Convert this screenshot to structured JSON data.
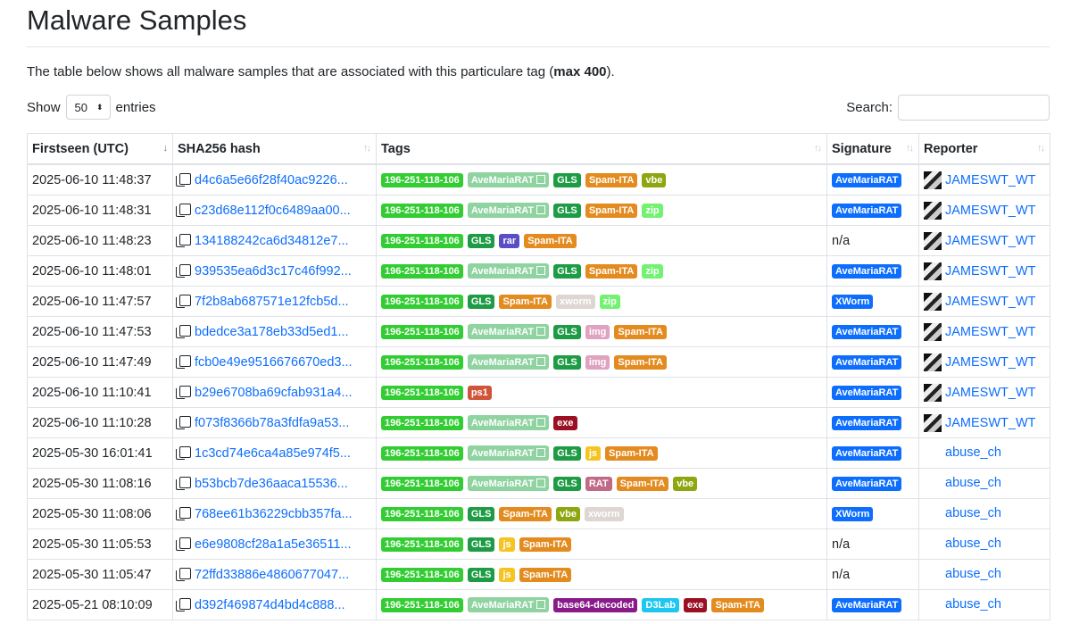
{
  "title": "Malware Samples",
  "intro_prefix": "The table below shows all malware samples that are associated with this particulare tag (",
  "intro_bold": "max 400",
  "intro_suffix": ").",
  "length": {
    "show": "Show",
    "value": "50",
    "entries": "entries"
  },
  "search": {
    "label": "Search:",
    "value": ""
  },
  "columns": [
    "Firstseen (UTC)",
    "SHA256 hash",
    "Tags",
    "Signature",
    "Reporter"
  ],
  "rows": [
    {
      "date": "2025-06-10 11:48:37",
      "hash": "d4c6a5e66f28f40ac9226...",
      "tags": [
        [
          "196-251-118-106",
          "ip"
        ],
        [
          "AveMariaRAT",
          "ave"
        ],
        [
          "GLS",
          "gls"
        ],
        [
          "Spam-ITA",
          "spam"
        ],
        [
          "vbe",
          "vbe"
        ]
      ],
      "signature": "AveMariaRAT",
      "reporter": "JAMESWT_WT",
      "rep_icon": "avatar"
    },
    {
      "date": "2025-06-10 11:48:31",
      "hash": "c23d68e112f0c6489aa00...",
      "tags": [
        [
          "196-251-118-106",
          "ip"
        ],
        [
          "AveMariaRAT",
          "ave"
        ],
        [
          "GLS",
          "gls"
        ],
        [
          "Spam-ITA",
          "spam"
        ],
        [
          "zip",
          "zip"
        ]
      ],
      "signature": "AveMariaRAT",
      "reporter": "JAMESWT_WT",
      "rep_icon": "avatar"
    },
    {
      "date": "2025-06-10 11:48:23",
      "hash": "134188242ca6d34812e7...",
      "tags": [
        [
          "196-251-118-106",
          "ip"
        ],
        [
          "GLS",
          "gls"
        ],
        [
          "rar",
          "rar"
        ],
        [
          "Spam-ITA",
          "spam"
        ]
      ],
      "signature": "",
      "signature_text": "n/a",
      "reporter": "JAMESWT_WT",
      "rep_icon": "avatar"
    },
    {
      "date": "2025-06-10 11:48:01",
      "hash": "939535ea6d3c17c46f992...",
      "tags": [
        [
          "196-251-118-106",
          "ip"
        ],
        [
          "AveMariaRAT",
          "ave"
        ],
        [
          "GLS",
          "gls"
        ],
        [
          "Spam-ITA",
          "spam"
        ],
        [
          "zip",
          "zip"
        ]
      ],
      "signature": "AveMariaRAT",
      "reporter": "JAMESWT_WT",
      "rep_icon": "avatar"
    },
    {
      "date": "2025-06-10 11:47:57",
      "hash": "7f2b8ab687571e12fcb5d...",
      "tags": [
        [
          "196-251-118-106",
          "ip"
        ],
        [
          "GLS",
          "gls"
        ],
        [
          "Spam-ITA",
          "spam"
        ],
        [
          "xworm",
          "xworm"
        ],
        [
          "zip",
          "zip"
        ]
      ],
      "signature": "XWorm",
      "reporter": "JAMESWT_WT",
      "rep_icon": "avatar"
    },
    {
      "date": "2025-06-10 11:47:53",
      "hash": "bdedce3a178eb33d5ed1...",
      "tags": [
        [
          "196-251-118-106",
          "ip"
        ],
        [
          "AveMariaRAT",
          "ave"
        ],
        [
          "GLS",
          "gls"
        ],
        [
          "img",
          "img"
        ],
        [
          "Spam-ITA",
          "spam"
        ]
      ],
      "signature": "AveMariaRAT",
      "reporter": "JAMESWT_WT",
      "rep_icon": "avatar"
    },
    {
      "date": "2025-06-10 11:47:49",
      "hash": "fcb0e49e9516676670ed3...",
      "tags": [
        [
          "196-251-118-106",
          "ip"
        ],
        [
          "AveMariaRAT",
          "ave"
        ],
        [
          "GLS",
          "gls"
        ],
        [
          "img",
          "img"
        ],
        [
          "Spam-ITA",
          "spam"
        ]
      ],
      "signature": "AveMariaRAT",
      "reporter": "JAMESWT_WT",
      "rep_icon": "avatar"
    },
    {
      "date": "2025-06-10 11:10:41",
      "hash": "b29e6708ba69cfab931a4...",
      "tags": [
        [
          "196-251-118-106",
          "ip"
        ],
        [
          "ps1",
          "ps1"
        ]
      ],
      "signature": "AveMariaRAT",
      "reporter": "JAMESWT_WT",
      "rep_icon": "avatar"
    },
    {
      "date": "2025-06-10 11:10:28",
      "hash": "f073f8366b78a3fdfa9a53...",
      "tags": [
        [
          "196-251-118-106",
          "ip"
        ],
        [
          "AveMariaRAT",
          "ave"
        ],
        [
          "exe",
          "exe"
        ]
      ],
      "signature": "AveMariaRAT",
      "reporter": "JAMESWT_WT",
      "rep_icon": "avatar"
    },
    {
      "date": "2025-05-30 16:01:41",
      "hash": "1c3cd74e6ca4a85e974f5...",
      "tags": [
        [
          "196-251-118-106",
          "ip"
        ],
        [
          "AveMariaRAT",
          "ave"
        ],
        [
          "GLS",
          "gls"
        ],
        [
          "js",
          "js"
        ],
        [
          "Spam-ITA",
          "spam"
        ]
      ],
      "signature": "AveMariaRAT",
      "reporter": "abuse_ch",
      "rep_icon": "abuse"
    },
    {
      "date": "2025-05-30 11:08:16",
      "hash": "b53bcb7de36aaca15536...",
      "tags": [
        [
          "196-251-118-106",
          "ip"
        ],
        [
          "AveMariaRAT",
          "ave"
        ],
        [
          "GLS",
          "gls"
        ],
        [
          "RAT",
          "rat"
        ],
        [
          "Spam-ITA",
          "spam"
        ],
        [
          "vbe",
          "vbe"
        ]
      ],
      "signature": "AveMariaRAT",
      "reporter": "abuse_ch",
      "rep_icon": "abuse"
    },
    {
      "date": "2025-05-30 11:08:06",
      "hash": "768ee61b36229cbb357fa...",
      "tags": [
        [
          "196-251-118-106",
          "ip"
        ],
        [
          "GLS",
          "gls"
        ],
        [
          "Spam-ITA",
          "spam"
        ],
        [
          "vbe",
          "vbe"
        ],
        [
          "xworm",
          "xworm"
        ]
      ],
      "signature": "XWorm",
      "reporter": "abuse_ch",
      "rep_icon": "abuse"
    },
    {
      "date": "2025-05-30 11:05:53",
      "hash": "e6e9808cf28a1a5e36511...",
      "tags": [
        [
          "196-251-118-106",
          "ip"
        ],
        [
          "GLS",
          "gls"
        ],
        [
          "js",
          "js"
        ],
        [
          "Spam-ITA",
          "spam"
        ]
      ],
      "signature": "",
      "signature_text": "n/a",
      "reporter": "abuse_ch",
      "rep_icon": "abuse"
    },
    {
      "date": "2025-05-30 11:05:47",
      "hash": "72ffd33886e4860677047...",
      "tags": [
        [
          "196-251-118-106",
          "ip"
        ],
        [
          "GLS",
          "gls"
        ],
        [
          "js",
          "js"
        ],
        [
          "Spam-ITA",
          "spam"
        ]
      ],
      "signature": "",
      "signature_text": "n/a",
      "reporter": "abuse_ch",
      "rep_icon": "abuse"
    },
    {
      "date": "2025-05-21 08:10:09",
      "hash": "d392f469874d4bd4c888...",
      "tags": [
        [
          "196-251-118-106",
          "ip"
        ],
        [
          "AveMariaRAT",
          "ave"
        ],
        [
          "base64-decoded",
          "b64"
        ],
        [
          "D3Lab",
          "d3"
        ],
        [
          "exe",
          "exe"
        ],
        [
          "Spam-ITA",
          "spam"
        ]
      ],
      "signature": "AveMariaRAT",
      "reporter": "abuse_ch",
      "rep_icon": "abuse"
    }
  ]
}
